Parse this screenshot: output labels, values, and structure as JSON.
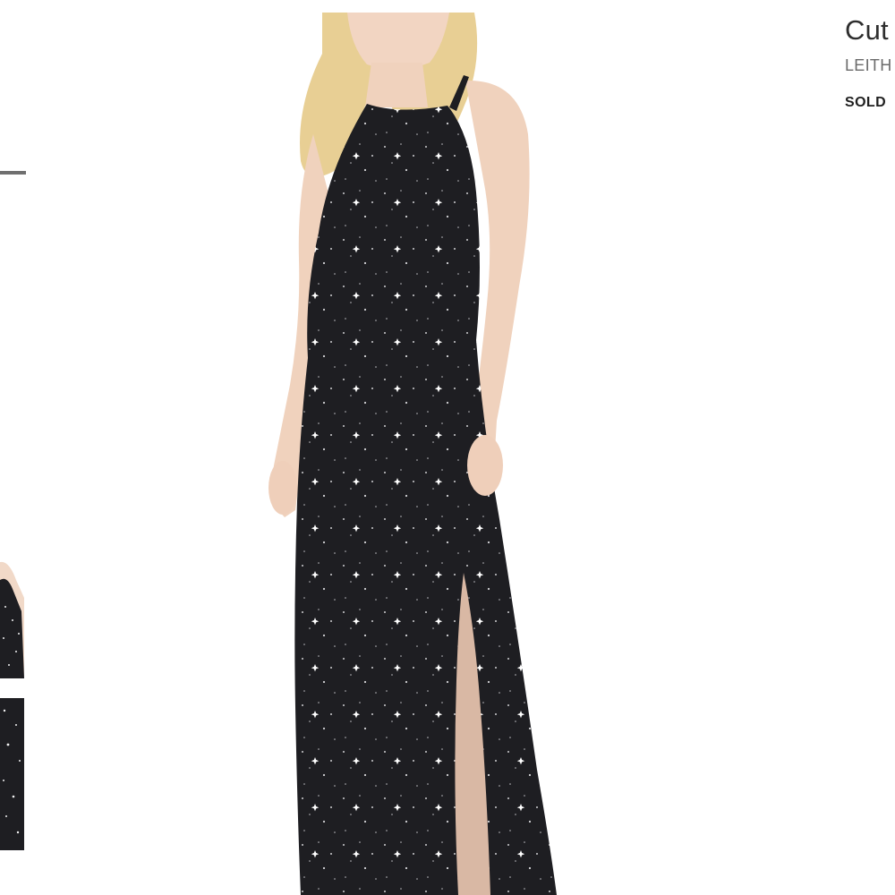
{
  "product": {
    "title": "Cut",
    "brand": "LEITH",
    "status": "SOLD"
  },
  "gallery": {
    "main_image": "dress-on-model-photo",
    "thumbnails": [
      "dress-thumbnail",
      "dress-detail-thumbnail"
    ],
    "active_index": 0
  },
  "colors": {
    "dress": "#1e1e22",
    "star": "#f2f2f2",
    "active_indicator": "#6f6f6f"
  }
}
